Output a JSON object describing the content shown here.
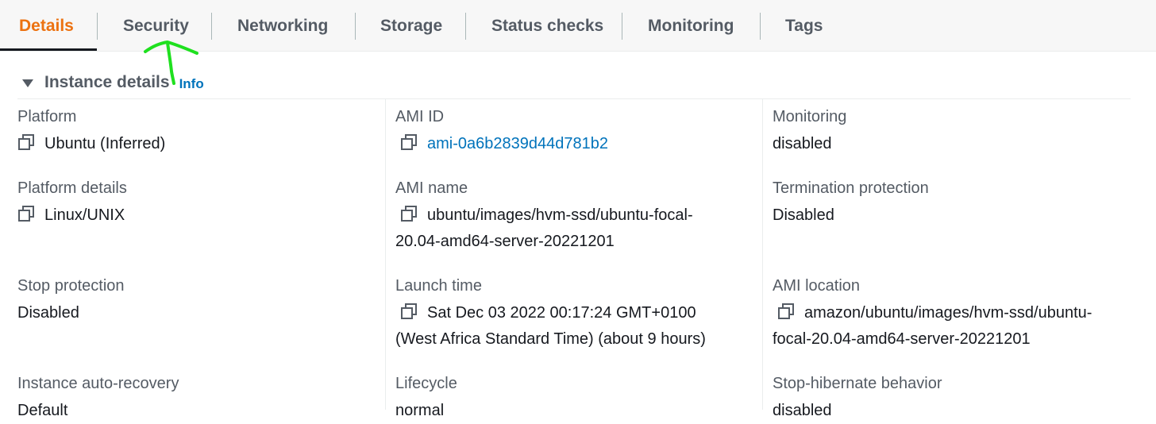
{
  "tabs": [
    {
      "label": "Details"
    },
    {
      "label": "Security"
    },
    {
      "label": "Networking"
    },
    {
      "label": "Storage"
    },
    {
      "label": "Status checks"
    },
    {
      "label": "Monitoring"
    },
    {
      "label": "Tags"
    }
  ],
  "active_tab": "Details",
  "section": {
    "title": "Instance details",
    "info_link": "Info"
  },
  "fields": {
    "platform": {
      "label": "Platform",
      "value": "Ubuntu (Inferred)"
    },
    "platform_details": {
      "label": "Platform details",
      "value": "Linux/UNIX"
    },
    "stop_protection": {
      "label": "Stop protection",
      "value": "Disabled"
    },
    "auto_recovery": {
      "label": "Instance auto-recovery",
      "value": "Default"
    },
    "ami_id": {
      "label": "AMI ID",
      "value": "ami-0a6b2839d44d781b2"
    },
    "ami_name": {
      "label": "AMI name",
      "value_line1": "ubuntu/images/hvm-ssd/ubuntu-focal-",
      "value_line2": "20.04-amd64-server-20221201"
    },
    "launch_time": {
      "label": "Launch time",
      "value_line1": "Sat Dec 03 2022 00:17:24 GMT+0100",
      "value_line2": "(West Africa Standard Time) (about 9 hours)"
    },
    "lifecycle": {
      "label": "Lifecycle",
      "value": "normal"
    },
    "monitoring": {
      "label": "Monitoring",
      "value": "disabled"
    },
    "termination_protection": {
      "label": "Termination protection",
      "value": "Disabled"
    },
    "ami_location": {
      "label": "AMI location",
      "value_line1": "amazon/ubuntu/images/hvm-ssd/ubuntu-",
      "value_line2": "focal-20.04-amd64-server-20221201"
    },
    "stop_hibernate": {
      "label": "Stop-hibernate behavior",
      "value": "disabled"
    }
  },
  "icons": {
    "copy": "copy-icon",
    "collapse": "caret-down-icon",
    "annotation": "green-arrow-annotation"
  },
  "colors": {
    "active_tab": "#ec7211",
    "link": "#0073bb",
    "label": "#545b64",
    "value": "#16191f",
    "annotation": "#1fe01f"
  }
}
